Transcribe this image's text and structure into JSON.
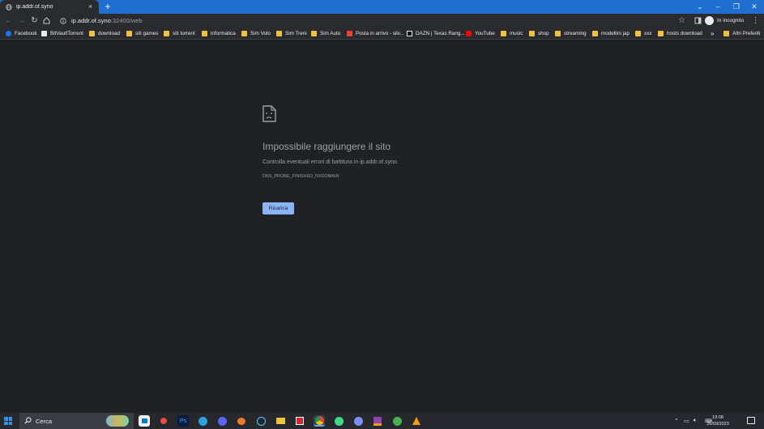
{
  "browser": {
    "tab_title": "ip.addr.of.syno",
    "url_host": "ip.addr.of.syno",
    "url_path": ":32400/web",
    "profile_label": "In incognito"
  },
  "bookmarks": [
    {
      "label": "Facebook",
      "icon": "facebook-icon",
      "color": "#1877f2"
    },
    {
      "label": "BitVaultTorrent",
      "icon": "bitvault-icon",
      "color": "#ffffff"
    },
    {
      "label": "download",
      "icon": "folder-icon"
    },
    {
      "label": "siti games",
      "icon": "folder-icon"
    },
    {
      "label": "siti torrent",
      "icon": "folder-icon"
    },
    {
      "label": "informatica",
      "icon": "folder-icon"
    },
    {
      "label": "Sim Volo",
      "icon": "folder-icon"
    },
    {
      "label": "Sim Treni",
      "icon": "folder-icon"
    },
    {
      "label": "Sim Auto",
      "icon": "folder-icon"
    },
    {
      "label": "Posta in arrivo - silv...",
      "icon": "gmail-icon",
      "color": "#ea4335"
    },
    {
      "label": "DAZN | Texas Rang...",
      "icon": "dazn-icon",
      "color": "#0c0c0c"
    },
    {
      "label": "YouTube",
      "icon": "youtube-icon",
      "color": "#ff0000"
    },
    {
      "label": "music",
      "icon": "folder-icon"
    },
    {
      "label": "shop",
      "icon": "folder-icon"
    },
    {
      "label": "streaming",
      "icon": "folder-icon"
    },
    {
      "label": "modellini jap",
      "icon": "folder-icon"
    },
    {
      "label": "xxx",
      "icon": "folder-icon"
    },
    {
      "label": "hosts download",
      "icon": "folder-icon"
    }
  ],
  "bookmarks_more": "»",
  "other_bookmarks": "Altri Preferiti",
  "error": {
    "title": "Impossibile raggiungere il sito",
    "message": "Controlla eventuali errori di battitura in ip.addr.of.syno.",
    "code": "DNS_PROBE_FINISHED_NXDOMAIN",
    "reload_label": "Ricarica"
  },
  "taskbar": {
    "search_placeholder": "Cerca",
    "time": "19:08",
    "date": "26/03/2023"
  },
  "colors": {
    "accent": "#1f6fd1",
    "page_bg": "#202124",
    "button": "#8ab4f8",
    "text_muted": "#9aa0a6"
  }
}
